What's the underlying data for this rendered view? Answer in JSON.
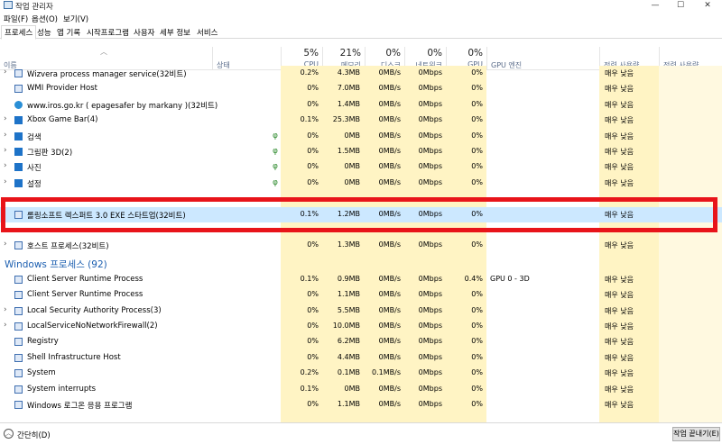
{
  "window": {
    "title": "작업 관리자",
    "minimize": "—",
    "maximize": "☐",
    "close": "✕"
  },
  "menu": [
    "파일(F)",
    "옵션(O)",
    "보기(V)"
  ],
  "tabs": [
    "프로세스",
    "성능",
    "앱 기록",
    "시작프로그램",
    "사용자",
    "세부 정보",
    "서비스"
  ],
  "columns": {
    "name": "이름",
    "status": "상태",
    "cpu": {
      "pct": "5%",
      "label": "CPU"
    },
    "memory": {
      "pct": "21%",
      "label": "메모리"
    },
    "disk": {
      "pct": "0%",
      "label": "디스크"
    },
    "network": {
      "pct": "0%",
      "label": "네트워크"
    },
    "gpu": {
      "pct": "0%",
      "label": "GPU"
    },
    "gpu_engine": "GPU 엔진",
    "power": "전력 사용량",
    "power_trend": "전력 사용량 ..."
  },
  "rows": [
    {
      "name": "Wizvera process manager service(32비트)",
      "cpu": "0.2%",
      "mem": "4.3MB",
      "disk": "0MB/s",
      "net": "0Mbps",
      "gpu": "0%",
      "engine": "",
      "power": "매우 낮음",
      "expand": true,
      "icon": "app",
      "leaf": false
    },
    {
      "name": "WMI Provider Host",
      "cpu": "0%",
      "mem": "7.0MB",
      "disk": "0MB/s",
      "net": "0Mbps",
      "gpu": "0%",
      "engine": "",
      "power": "매우 낮음",
      "expand": false,
      "icon": "app",
      "leaf": false
    },
    {
      "name": "www.iros.go.kr ( epagesafer by markany )(32비트)",
      "cpu": "0%",
      "mem": "1.4MB",
      "disk": "0MB/s",
      "net": "0Mbps",
      "gpu": "0%",
      "engine": "",
      "power": "매우 낮음",
      "expand": false,
      "icon": "web",
      "leaf": false
    },
    {
      "name": "Xbox Game Bar(4)",
      "cpu": "0.1%",
      "mem": "25.3MB",
      "disk": "0MB/s",
      "net": "0Mbps",
      "gpu": "0%",
      "engine": "",
      "power": "매우 낮음",
      "expand": true,
      "icon": "blue",
      "leaf": false
    },
    {
      "name": "검색",
      "cpu": "0%",
      "mem": "0MB",
      "disk": "0MB/s",
      "net": "0Mbps",
      "gpu": "0%",
      "engine": "",
      "power": "매우 낮음",
      "expand": true,
      "icon": "blue",
      "leaf": true
    },
    {
      "name": "그림판 3D(2)",
      "cpu": "0%",
      "mem": "1.5MB",
      "disk": "0MB/s",
      "net": "0Mbps",
      "gpu": "0%",
      "engine": "",
      "power": "매우 낮음",
      "expand": true,
      "icon": "blue",
      "leaf": true
    },
    {
      "name": "사진",
      "cpu": "0%",
      "mem": "0MB",
      "disk": "0MB/s",
      "net": "0Mbps",
      "gpu": "0%",
      "engine": "",
      "power": "매우 낮음",
      "expand": true,
      "icon": "blue",
      "leaf": true
    },
    {
      "name": "설정",
      "cpu": "0%",
      "mem": "0MB",
      "disk": "0MB/s",
      "net": "0Mbps",
      "gpu": "0%",
      "engine": "",
      "power": "매우 낮음",
      "expand": true,
      "icon": "blue",
      "leaf": true
    },
    {
      "name": "",
      "cpu": "",
      "mem": "",
      "disk": "",
      "net": "",
      "gpu": "",
      "engine": "",
      "power": "",
      "expand": false,
      "icon": "none",
      "leaf": false
    },
    {
      "name": "롤링소프트 렉스퍼트 3.0 EXE 스타트업(32비트)",
      "cpu": "0.1%",
      "mem": "1.2MB",
      "disk": "0MB/s",
      "net": "0Mbps",
      "gpu": "0%",
      "engine": "",
      "power": "매우 낮음",
      "expand": false,
      "icon": "app",
      "leaf": false,
      "selected": true
    },
    {
      "name": "",
      "cpu": "",
      "mem": "",
      "disk": "",
      "net": "",
      "gpu": "",
      "engine": "",
      "power": "",
      "expand": false,
      "icon": "none",
      "leaf": false
    },
    {
      "name": "호스트 프로세스(32비트)",
      "cpu": "0%",
      "mem": "1.3MB",
      "disk": "0MB/s",
      "net": "0Mbps",
      "gpu": "0%",
      "engine": "",
      "power": "매우 낮음",
      "expand": true,
      "icon": "app",
      "leaf": false
    }
  ],
  "group": {
    "label": "Windows 프로세스 (92)"
  },
  "windows_rows": [
    {
      "name": "Client Server Runtime Process",
      "cpu": "0.1%",
      "mem": "0.9MB",
      "disk": "0MB/s",
      "net": "0Mbps",
      "gpu": "0.4%",
      "engine": "GPU 0 - 3D",
      "power": "매우 낮음",
      "expand": false
    },
    {
      "name": "Client Server Runtime Process",
      "cpu": "0%",
      "mem": "1.1MB",
      "disk": "0MB/s",
      "net": "0Mbps",
      "gpu": "0%",
      "engine": "",
      "power": "매우 낮음",
      "expand": false
    },
    {
      "name": "Local Security Authority Process(3)",
      "cpu": "0%",
      "mem": "5.5MB",
      "disk": "0MB/s",
      "net": "0Mbps",
      "gpu": "0%",
      "engine": "",
      "power": "매우 낮음",
      "expand": true
    },
    {
      "name": "LocalServiceNoNetworkFirewall(2)",
      "cpu": "0%",
      "mem": "10.0MB",
      "disk": "0MB/s",
      "net": "0Mbps",
      "gpu": "0%",
      "engine": "",
      "power": "매우 낮음",
      "expand": true
    },
    {
      "name": "Registry",
      "cpu": "0%",
      "mem": "6.2MB",
      "disk": "0MB/s",
      "net": "0Mbps",
      "gpu": "0%",
      "engine": "",
      "power": "매우 낮음",
      "expand": false
    },
    {
      "name": "Shell Infrastructure Host",
      "cpu": "0%",
      "mem": "4.4MB",
      "disk": "0MB/s",
      "net": "0Mbps",
      "gpu": "0%",
      "engine": "",
      "power": "매우 낮음",
      "expand": false
    },
    {
      "name": "System",
      "cpu": "0.2%",
      "mem": "0.1MB",
      "disk": "0.1MB/s",
      "net": "0Mbps",
      "gpu": "0%",
      "engine": "",
      "power": "매우 낮음",
      "expand": false
    },
    {
      "name": "System interrupts",
      "cpu": "0.1%",
      "mem": "0MB",
      "disk": "0MB/s",
      "net": "0Mbps",
      "gpu": "0%",
      "engine": "",
      "power": "매우 낮음",
      "expand": false
    },
    {
      "name": "Windows 로그온 응용 프로그램",
      "cpu": "0%",
      "mem": "1.1MB",
      "disk": "0MB/s",
      "net": "0Mbps",
      "gpu": "0%",
      "engine": "",
      "power": "매우 낮음",
      "expand": false
    }
  ],
  "footer": {
    "collapse_label": "간단히(D)",
    "end_task": "작업 끝내기(E)"
  },
  "colors": {
    "heat": "#fff4c4",
    "heat_alt": "#fff9e0",
    "selected": "#cce8ff",
    "group_text": "#1c5fb0",
    "highlight": "#e8141a"
  }
}
